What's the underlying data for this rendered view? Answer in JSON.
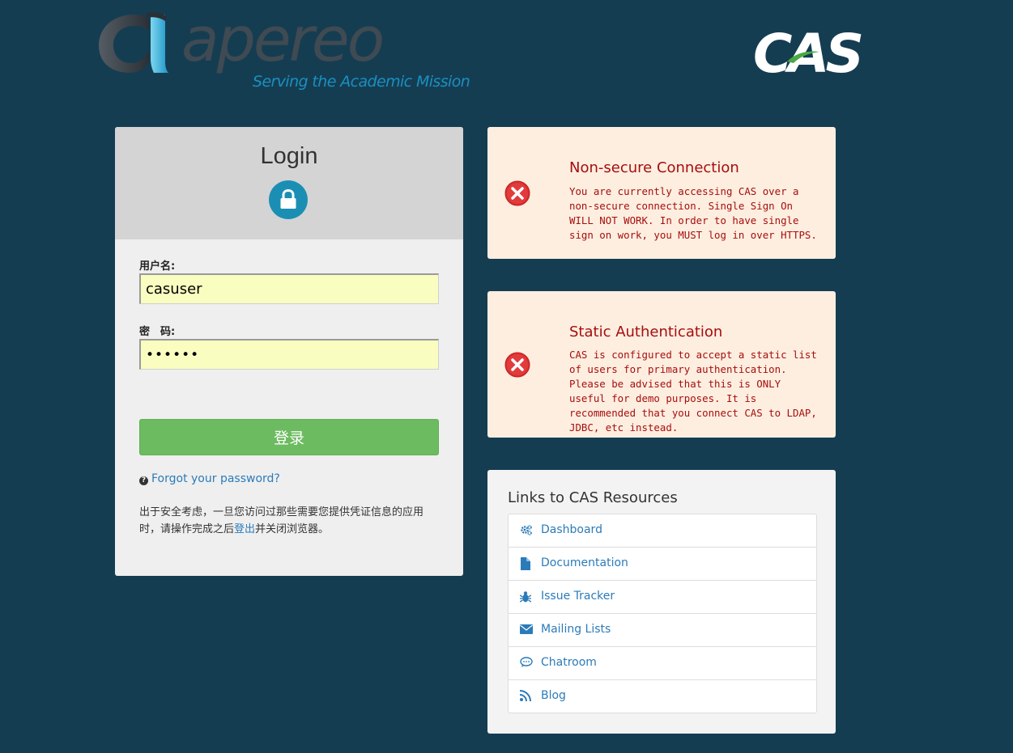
{
  "header": {
    "apereo_word": "apereo",
    "apereo_tagline": "Serving the Academic Mission",
    "cas_logo": "CAS"
  },
  "login": {
    "title": "Login",
    "username_label": "用户名:",
    "username_value": "casuser",
    "password_label": "密　码:",
    "password_value": "••••••",
    "submit_label": "登录",
    "forgot_label": "Forgot your password?",
    "security_note_before": "出于安全考虑，一旦您访问过那些需要您提供凭证信息的应用时，请操作完成之后",
    "security_note_link": "登出",
    "security_note_after": "并关闭浏览器。"
  },
  "warnings": [
    {
      "title": "Non-secure Connection",
      "body": "You are currently accessing CAS over a non-secure connection. Single Sign On WILL NOT WORK. In order to have single sign on work, you MUST log in over HTTPS."
    },
    {
      "title": "Static Authentication",
      "body": "CAS is configured to accept a static list of users for primary authentication. Please be advised that this is ONLY useful for demo purposes. It is recommended that you connect CAS to LDAP, JDBC, etc instead."
    }
  ],
  "resources": {
    "title": "Links to CAS Resources",
    "links": [
      {
        "label": "Dashboard",
        "icon": "gears-icon"
      },
      {
        "label": "Documentation",
        "icon": "file-icon"
      },
      {
        "label": "Issue Tracker",
        "icon": "bug-icon"
      },
      {
        "label": "Mailing Lists",
        "icon": "envelope-icon"
      },
      {
        "label": "Chatroom",
        "icon": "comment-icon"
      },
      {
        "label": "Blog",
        "icon": "rss-icon"
      }
    ]
  },
  "colors": {
    "background": "#153d52",
    "submit": "#6cbb60",
    "link": "#2b7bb9",
    "warning_text": "#a50e0e",
    "warning_bg": "#feeee0"
  }
}
